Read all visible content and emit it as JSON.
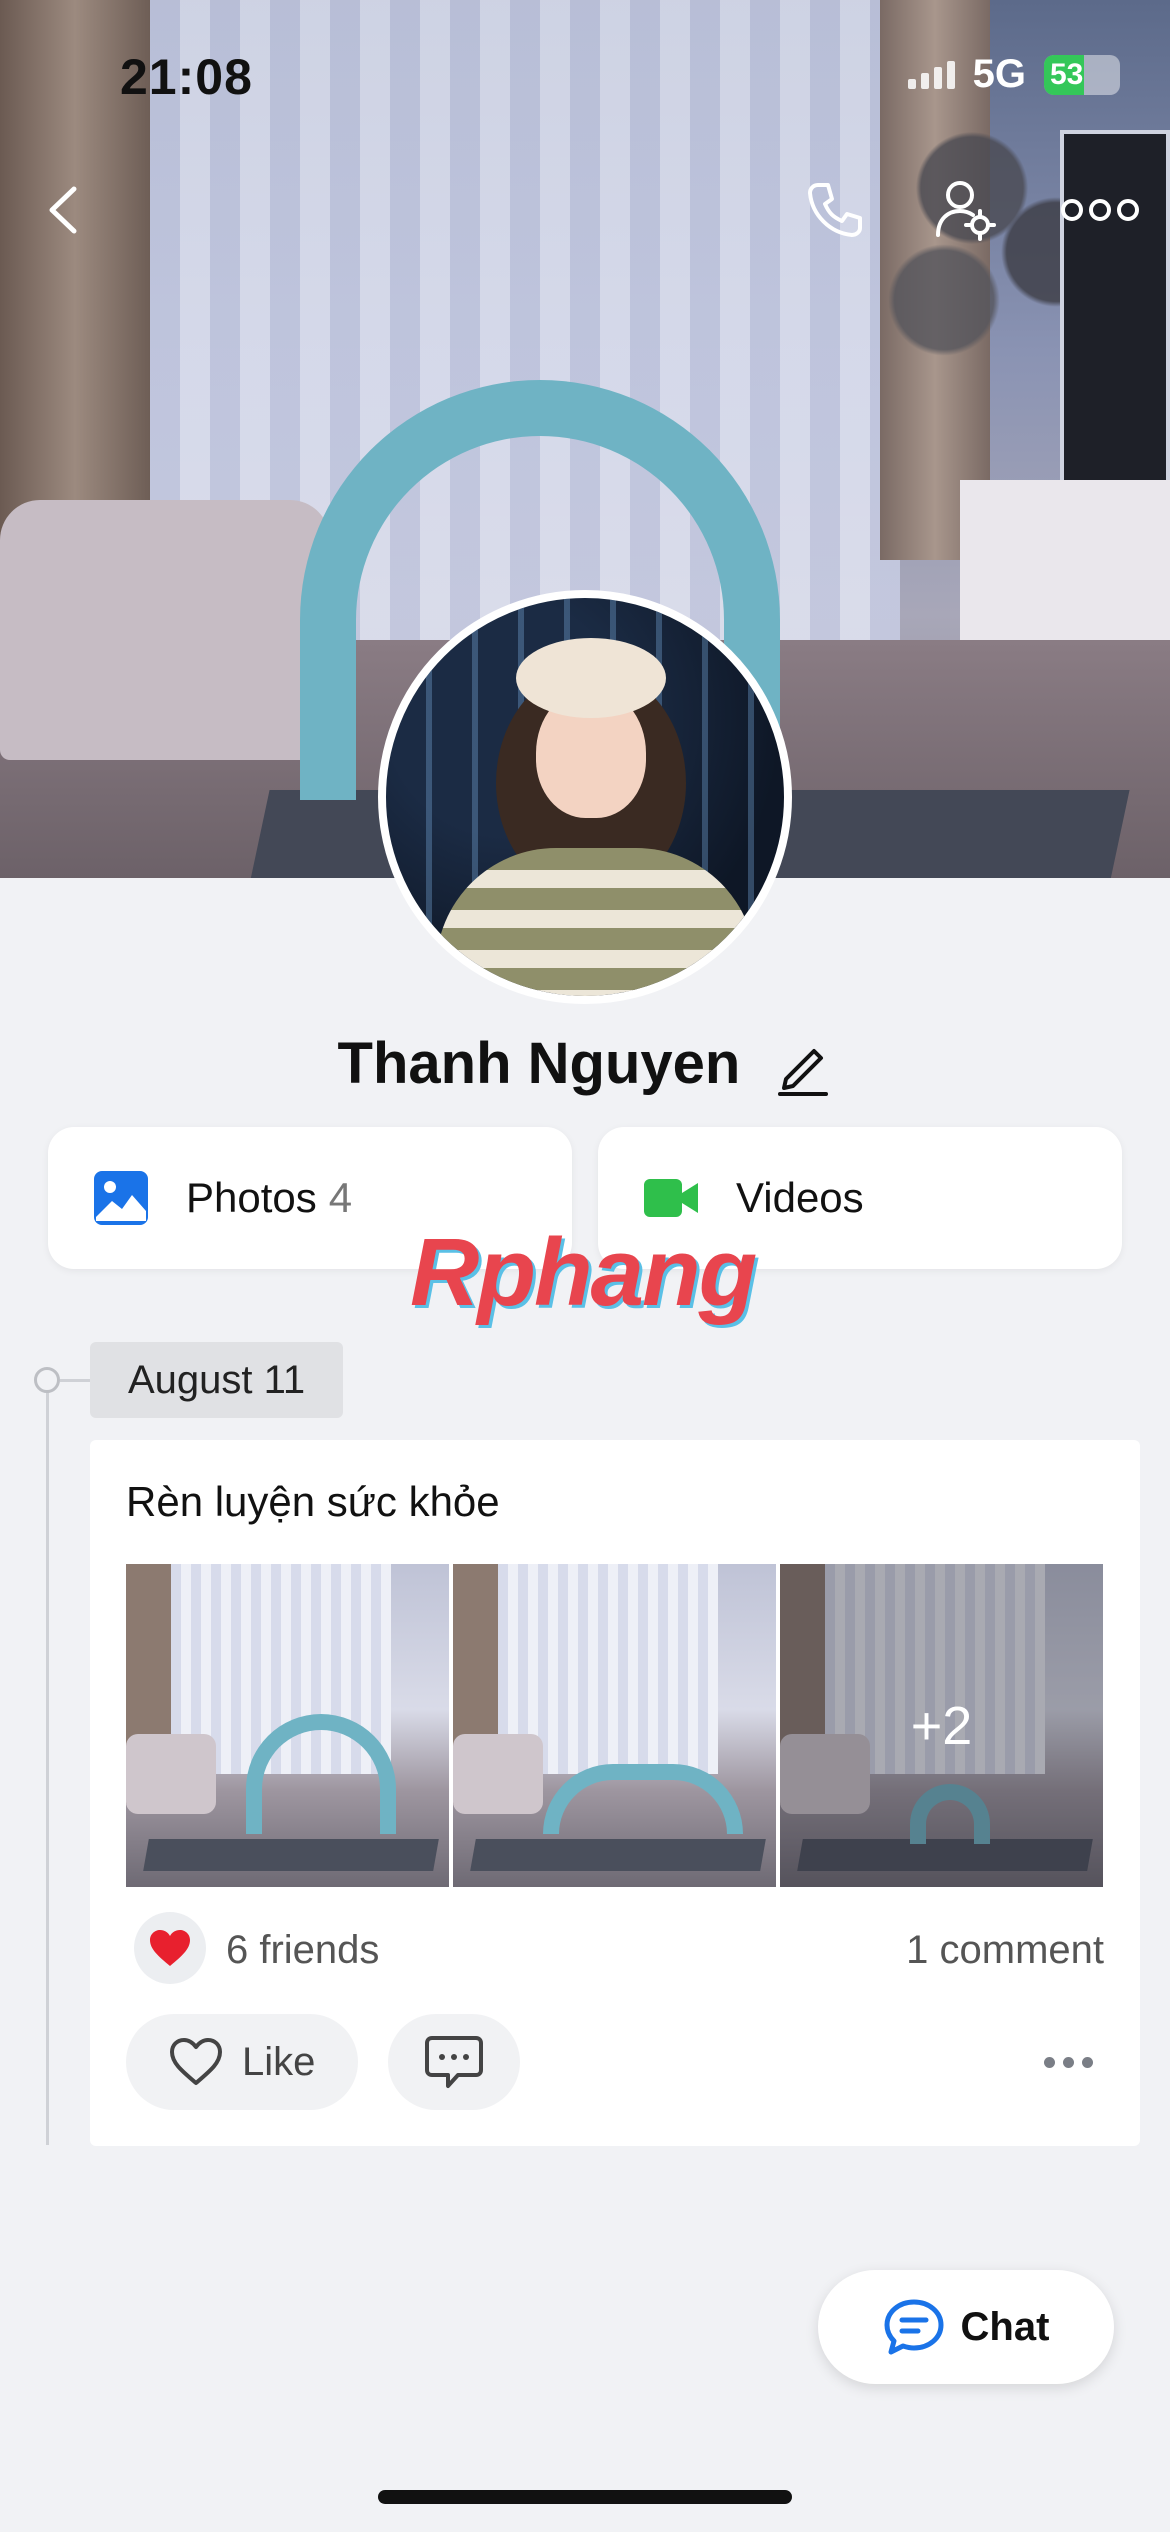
{
  "status_bar": {
    "time": "21:08",
    "network": "5G",
    "battery_level": "53",
    "battery_fraction": 0.53
  },
  "top_bar": {
    "icons": [
      "back-icon",
      "call-icon",
      "profile-settings-icon",
      "more-icon"
    ]
  },
  "profile": {
    "name": "Thanh Nguyen"
  },
  "media": {
    "photos": {
      "label": "Photos",
      "count": "4"
    },
    "videos": {
      "label": "Videos"
    }
  },
  "watermark": "Rphang",
  "timeline": {
    "date": "August 11",
    "post": {
      "text": "Rèn luyện sức khỏe",
      "extra_photos": "+2",
      "reactions": "6 friends",
      "comments": "1 comment",
      "like_label": "Like"
    }
  },
  "chat_button": {
    "label": "Chat"
  },
  "colors": {
    "photos_icon": "#1a73e8",
    "videos_icon": "#2fbf4b",
    "chat_icon": "#1a73e8",
    "heart": "#e8202e",
    "battery": "#34c759"
  }
}
